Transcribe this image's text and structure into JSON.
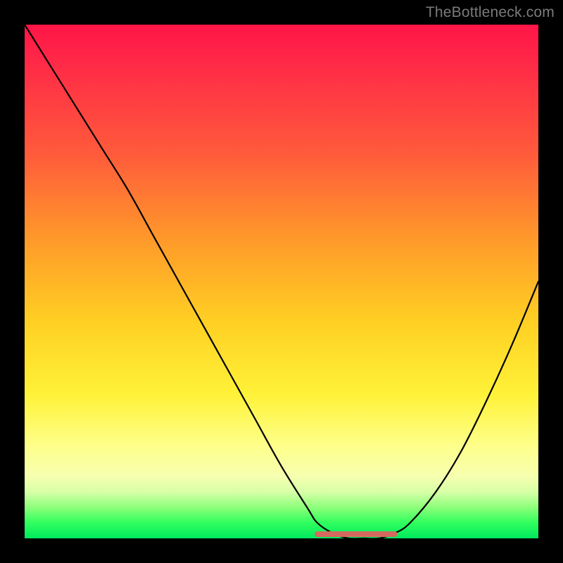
{
  "watermark": "TheBottleneck.com",
  "chart_data": {
    "type": "line",
    "title": "",
    "xlabel": "",
    "ylabel": "",
    "xlim": [
      0,
      100
    ],
    "ylim": [
      0,
      100
    ],
    "grid": false,
    "legend": false,
    "background_gradient": [
      "#ff1547",
      "#ff5a3b",
      "#ffd023",
      "#feff8a",
      "#00e85e"
    ],
    "series": [
      {
        "name": "curve",
        "stroke": "#000000",
        "x": [
          0,
          5,
          10,
          15,
          20,
          25,
          30,
          35,
          40,
          45,
          50,
          55,
          57,
          60,
          63,
          66,
          69,
          72,
          75,
          80,
          85,
          90,
          95,
          100
        ],
        "y": [
          100,
          92,
          84,
          76,
          68,
          59,
          50,
          41,
          32,
          23,
          14,
          6,
          3,
          1,
          0,
          0,
          0,
          1,
          3,
          9,
          17,
          27,
          38,
          50
        ]
      },
      {
        "name": "flat-bottom-marker",
        "stroke": "#d46a5f",
        "x": [
          57,
          72
        ],
        "y": [
          0,
          0
        ]
      }
    ],
    "annotations": []
  }
}
